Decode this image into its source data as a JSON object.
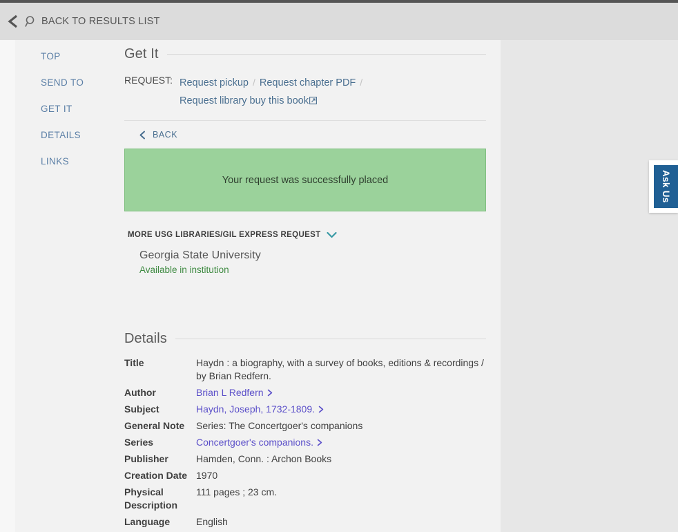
{
  "header": {
    "back_to_results_label": "BACK TO RESULTS LIST",
    "back_icon": "chevron-left-icon",
    "search_icon": "search-icon"
  },
  "sidebar": {
    "items": [
      {
        "label": "TOP"
      },
      {
        "label": "SEND TO"
      },
      {
        "label": "GET IT"
      },
      {
        "label": "DETAILS"
      },
      {
        "label": "LINKS"
      }
    ]
  },
  "get_it": {
    "section_title": "Get It",
    "request_label": "REQUEST:",
    "links": [
      {
        "label": "Request pickup",
        "external": false
      },
      {
        "label": "Request chapter PDF",
        "external": false
      },
      {
        "label": "Request library buy this book",
        "external": true
      }
    ],
    "separator": "/",
    "back_button": {
      "label": "BACK",
      "icon": "chevron-left-icon"
    },
    "success_message": "Your request was successfully placed",
    "success_bg_color": "#9bd29b",
    "usg": {
      "header_label": "MORE USG LIBRARIES/GIL EXPRESS REQUEST",
      "toggle_icon": "chevron-down-icon",
      "toggle_color": "#3a9aa5",
      "institution": "Georgia State University",
      "availability": "Available in institution",
      "availability_color": "#3f8a42"
    }
  },
  "details": {
    "section_title": "Details",
    "rows": [
      {
        "key": "Title",
        "value": "Haydn : a biography, with a survey of books, editions & recordings / by Brian Redfern.",
        "link": false
      },
      {
        "key": "Author",
        "value": "Brian L Redfern",
        "link": true
      },
      {
        "key": "Subject",
        "value": "Haydn, Joseph, 1732-1809.",
        "link": true
      },
      {
        "key": "General Note",
        "value": "Series: The Concertgoer's companions",
        "link": false
      },
      {
        "key": "Series",
        "value": "Concertgoer's companions.",
        "link": true
      },
      {
        "key": "Publisher",
        "value": "Hamden, Conn. : Archon Books",
        "link": false
      },
      {
        "key": "Creation Date",
        "value": "1970",
        "link": false
      },
      {
        "key": "Physical Description",
        "value": "111 pages ; 23 cm.",
        "link": false
      },
      {
        "key": "Language",
        "value": "English",
        "link": false
      }
    ],
    "link_color": "#5b4fc9",
    "link_arrow_icon": "chevron-right-icon"
  },
  "ask_us": {
    "label": "Ask Us",
    "bg_color": "#1f5f94"
  }
}
